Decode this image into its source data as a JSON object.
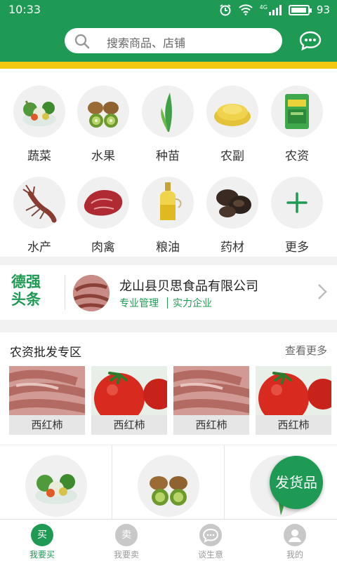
{
  "status_bar": {
    "time": "10:33",
    "network": "4G",
    "battery": "93"
  },
  "header": {
    "search_placeholder": "搜索商品、店铺"
  },
  "categories": [
    {
      "label": "蔬菜",
      "icon": "vegetables-icon"
    },
    {
      "label": "水果",
      "icon": "kiwi-fruit-icon"
    },
    {
      "label": "种苗",
      "icon": "seedling-icon"
    },
    {
      "label": "农副",
      "icon": "millet-icon"
    },
    {
      "label": "农资",
      "icon": "fertilizer-bag-icon"
    },
    {
      "label": "水产",
      "icon": "lobster-icon"
    },
    {
      "label": "肉禽",
      "icon": "steak-icon"
    },
    {
      "label": "粮油",
      "icon": "oil-bottle-icon"
    },
    {
      "label": "药材",
      "icon": "mushroom-icon"
    },
    {
      "label": "更多",
      "icon": "plus-icon"
    }
  ],
  "news": {
    "logo_line1": "德强",
    "logo_line2": "头条",
    "company": "龙山县贝思食品有限公司",
    "tag1": "专业管理",
    "tag2": "实力企业"
  },
  "wholesale": {
    "title": "农资批发专区",
    "more": "查看更多",
    "products": [
      {
        "name": "西红柿",
        "image": "sweet-potato"
      },
      {
        "name": "西红柿",
        "image": "tomato"
      },
      {
        "name": "西红柿",
        "image": "sweet-potato"
      },
      {
        "name": "西红柿",
        "image": "tomato"
      }
    ]
  },
  "fab": {
    "label": "发货品"
  },
  "tabbar": [
    {
      "label": "我要买",
      "glyph": "买",
      "active": true
    },
    {
      "label": "我要卖",
      "glyph": "卖",
      "active": false
    },
    {
      "label": "谈生意",
      "glyph": "",
      "active": false
    },
    {
      "label": "我的",
      "glyph": "",
      "active": false
    }
  ],
  "colors": {
    "brand": "#1f9a54",
    "accent": "#f2c812",
    "inactive": "#c8c8c8"
  }
}
